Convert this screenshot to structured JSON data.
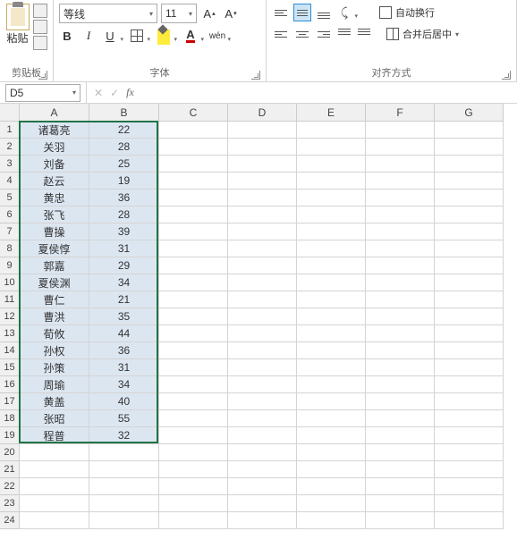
{
  "ribbon": {
    "clipboard": {
      "label": "剪贴板",
      "paste": "粘贴"
    },
    "font": {
      "label": "字体",
      "name": "等线",
      "size": "11",
      "bold": "B",
      "italic": "I",
      "underline": "U",
      "fontcolor_letter": "A",
      "phonetic": "wén"
    },
    "align": {
      "label": "对齐方式",
      "wrap": "自动换行",
      "merge": "合并后居中"
    }
  },
  "namebox": "D5",
  "columns": [
    "A",
    "B",
    "C",
    "D",
    "E",
    "F",
    "G"
  ],
  "row_count": 24,
  "selection": {
    "top": 0,
    "left": 0,
    "rows": 19,
    "cols": 2
  },
  "chart_data": {
    "type": "table",
    "columns": [
      "A",
      "B"
    ],
    "rows": [
      {
        "A": "诸葛亮",
        "B": 22
      },
      {
        "A": "关羽",
        "B": 28
      },
      {
        "A": "刘备",
        "B": 25
      },
      {
        "A": "赵云",
        "B": 19
      },
      {
        "A": "黄忠",
        "B": 36
      },
      {
        "A": "张飞",
        "B": 28
      },
      {
        "A": "曹操",
        "B": 39
      },
      {
        "A": "夏侯惇",
        "B": 31
      },
      {
        "A": "郭嘉",
        "B": 29
      },
      {
        "A": "夏侯渊",
        "B": 34
      },
      {
        "A": "曹仁",
        "B": 21
      },
      {
        "A": "曹洪",
        "B": 35
      },
      {
        "A": "荀攸",
        "B": 44
      },
      {
        "A": "孙权",
        "B": 36
      },
      {
        "A": "孙策",
        "B": 31
      },
      {
        "A": "周瑜",
        "B": 34
      },
      {
        "A": "黄盖",
        "B": 40
      },
      {
        "A": "张昭",
        "B": 55
      },
      {
        "A": "程普",
        "B": 32
      }
    ]
  }
}
